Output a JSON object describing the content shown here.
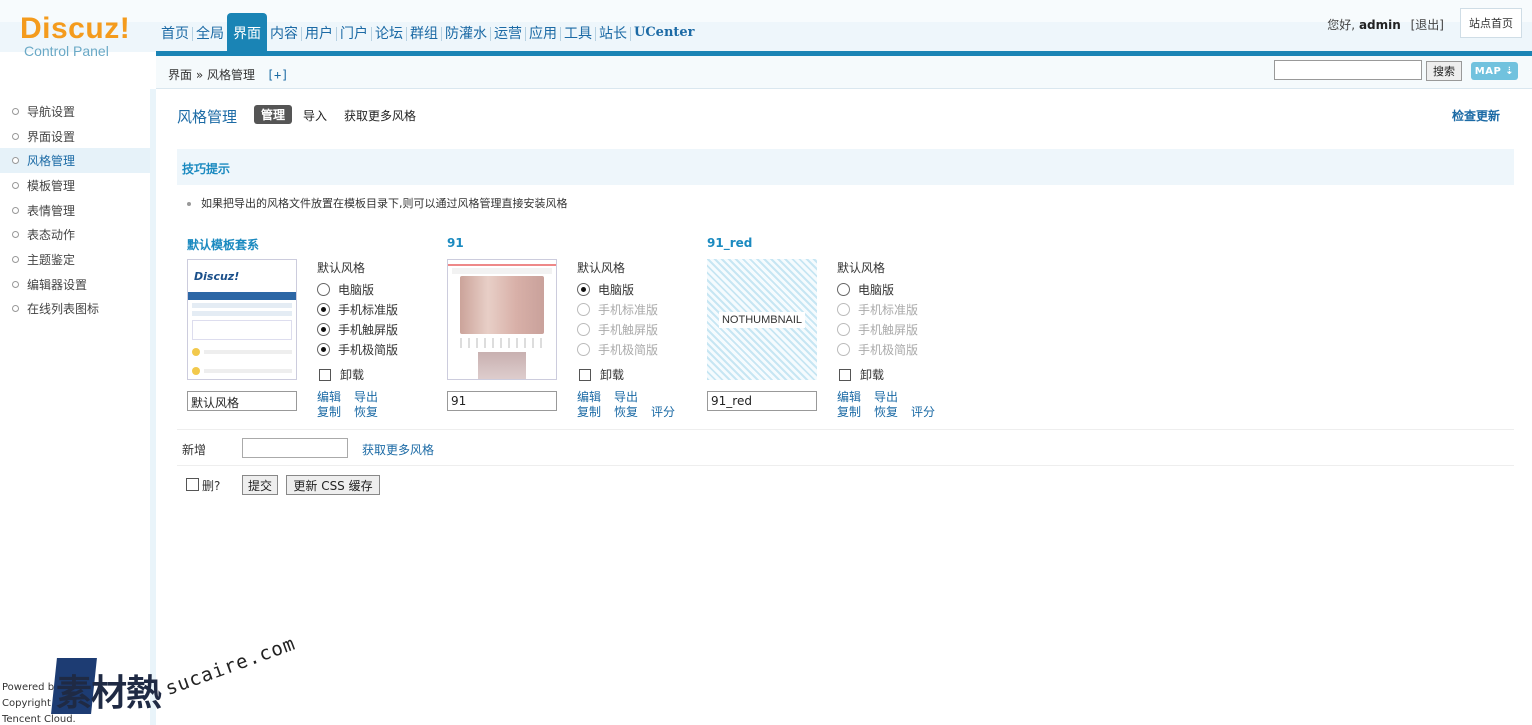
{
  "header": {
    "logo_brand": "Discuz!",
    "logo_sub": "Control Panel",
    "nav": [
      {
        "label": "首页"
      },
      {
        "label": "全局"
      },
      {
        "label": "界面"
      },
      {
        "label": "内容"
      },
      {
        "label": "用户"
      },
      {
        "label": "门户"
      },
      {
        "label": "论坛"
      },
      {
        "label": "群组"
      },
      {
        "label": "防灌水"
      },
      {
        "label": "运营"
      },
      {
        "label": "应用"
      },
      {
        "label": "工具"
      },
      {
        "label": "站长"
      },
      {
        "label": "UCenter"
      }
    ],
    "active_nav": "界面",
    "greeting": "您好,",
    "username": "admin",
    "logout": "[退出]",
    "site_home": "站点首页"
  },
  "subbar": {
    "breadcrumb": "界面 » 风格管理",
    "plus": "[+]",
    "search_value": "",
    "search_button": "搜索",
    "map_button": "MAP ⇣"
  },
  "sidebar": {
    "items": [
      {
        "label": "导航设置"
      },
      {
        "label": "界面设置"
      },
      {
        "label": "风格管理"
      },
      {
        "label": "模板管理"
      },
      {
        "label": "表情管理"
      },
      {
        "label": "表态动作"
      },
      {
        "label": "主题鉴定"
      },
      {
        "label": "编辑器设置"
      },
      {
        "label": "在线列表图标"
      }
    ],
    "active": "风格管理",
    "powered": [
      "Powered by",
      "Copyright © 2020",
      "Tencent Cloud."
    ]
  },
  "watermark": {
    "cn": "素材熱",
    "url": "sucaire.com"
  },
  "main": {
    "heading": "风格管理",
    "tab_manage": "管理",
    "tab_import": "导入",
    "tab_more": "获取更多风格",
    "check_update": "检查更新",
    "tips_title": "技巧提示",
    "tip": "如果把导出的风格文件放置在模板目录下,则可以通过风格管理直接安装风格",
    "styles": [
      {
        "title": "默认模板套系",
        "name_value": "默认风格",
        "options_label": "默认风格",
        "options": [
          {
            "label": "电脑版",
            "checked": false,
            "disabled": false
          },
          {
            "label": "手机标准版",
            "checked": true,
            "disabled": false
          },
          {
            "label": "手机触屏版",
            "checked": true,
            "disabled": false
          },
          {
            "label": "手机极简版",
            "checked": true,
            "disabled": false
          }
        ],
        "uninstall": "卸载",
        "links": [
          "编辑",
          "导出",
          "复制",
          "恢复"
        ]
      },
      {
        "title": "91",
        "name_value": "91",
        "options_label": "默认风格",
        "options": [
          {
            "label": "电脑版",
            "checked": true,
            "disabled": false
          },
          {
            "label": "手机标准版",
            "checked": false,
            "disabled": true
          },
          {
            "label": "手机触屏版",
            "checked": false,
            "disabled": true
          },
          {
            "label": "手机极简版",
            "checked": false,
            "disabled": true
          }
        ],
        "uninstall": "卸载",
        "links": [
          "编辑",
          "导出",
          "复制",
          "恢复",
          "评分"
        ]
      },
      {
        "title": "91_red",
        "name_value": "91_red",
        "thumb_text": "NOTHUMBNAIL",
        "options_label": "默认风格",
        "options": [
          {
            "label": "电脑版",
            "checked": false,
            "disabled": false
          },
          {
            "label": "手机标准版",
            "checked": false,
            "disabled": true
          },
          {
            "label": "手机触屏版",
            "checked": false,
            "disabled": true
          },
          {
            "label": "手机极简版",
            "checked": false,
            "disabled": true
          }
        ],
        "uninstall": "卸载",
        "links": [
          "编辑",
          "导出",
          "复制",
          "恢复",
          "评分"
        ]
      }
    ],
    "add_label": "新增",
    "add_more": "获取更多风格",
    "del_label": "删?",
    "submit": "提交",
    "update_css": "更新 CSS 缓存"
  },
  "colors": {
    "accent": "#1a84b5",
    "link": "#1b6aa5",
    "logo": "#f49b1d"
  }
}
